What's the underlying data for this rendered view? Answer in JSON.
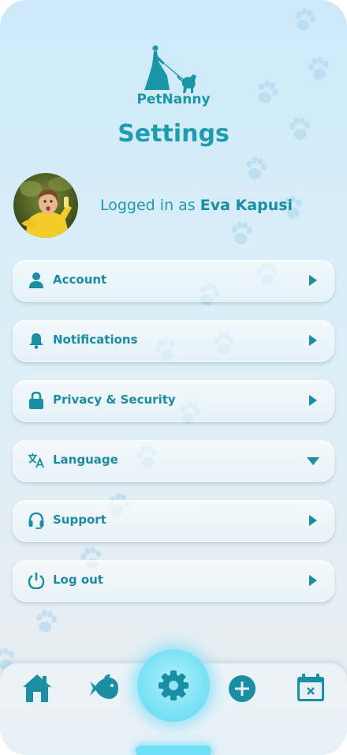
{
  "app": {
    "logo_text": "PetNanny"
  },
  "page": {
    "title": "Settings"
  },
  "profile": {
    "logged_prefix": "Logged in as",
    "user_name": "Eva Kapusi"
  },
  "menu": [
    {
      "label": "Account",
      "icon": "person-icon"
    },
    {
      "label": "Notifications",
      "icon": "bell-icon"
    },
    {
      "label": "Privacy & Security",
      "icon": "lock-icon"
    },
    {
      "label": "Language",
      "icon": "translate-icon",
      "expanded_indicator": "dropdown"
    },
    {
      "label": "Support",
      "icon": "headset-icon"
    },
    {
      "label": "Log out",
      "icon": "power-icon"
    }
  ],
  "nav": [
    "home-icon",
    "fish-icon",
    "gear-icon",
    "plus-icon",
    "calendar-icon"
  ],
  "colors": {
    "accent": "#1f9cae",
    "icon": "#1a8ea2",
    "glow": "#7fe3f6"
  }
}
